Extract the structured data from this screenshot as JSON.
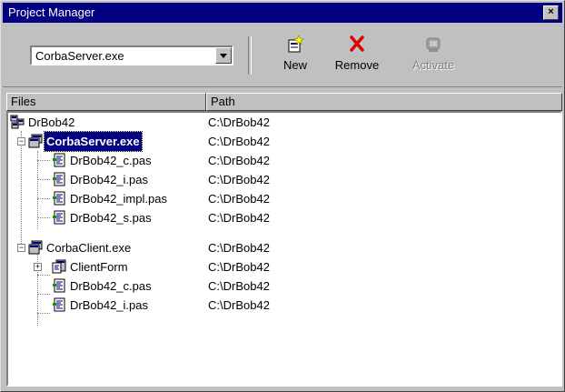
{
  "window": {
    "title": "Project Manager",
    "close_glyph": "×"
  },
  "toolbar": {
    "target_value": "CorbaServer.exe",
    "new_label": "New",
    "remove_label": "Remove",
    "activate_label": "Activate"
  },
  "columns": {
    "files": "Files",
    "path": "Path"
  },
  "tree": [
    {
      "name": "DrBob42",
      "path": "C:\\DrBob42",
      "icon": "project-group-icon"
    },
    {
      "name": "CorbaServer.exe",
      "path": "C:\\DrBob42",
      "icon": "exe-project-icon",
      "selected": true,
      "expanded": true
    },
    {
      "name": "DrBob42_c.pas",
      "path": "C:\\DrBob42",
      "icon": "pas-file-icon"
    },
    {
      "name": "DrBob42_i.pas",
      "path": "C:\\DrBob42",
      "icon": "pas-file-icon"
    },
    {
      "name": "DrBob42_impl.pas",
      "path": "C:\\DrBob42",
      "icon": "pas-file-icon"
    },
    {
      "name": "DrBob42_s.pas",
      "path": "C:\\DrBob42",
      "icon": "pas-file-icon"
    },
    {
      "name": "CorbaClient.exe",
      "path": "C:\\DrBob42",
      "icon": "exe-project-icon",
      "expanded": true
    },
    {
      "name": "ClientForm",
      "path": "C:\\DrBob42",
      "icon": "form-unit-icon",
      "expanded": false
    },
    {
      "name": "DrBob42_c.pas",
      "path": "C:\\DrBob42",
      "icon": "pas-file-icon"
    },
    {
      "name": "DrBob42_i.pas",
      "path": "C:\\DrBob42",
      "icon": "pas-file-icon"
    }
  ],
  "colors": {
    "title_bg": "#000080",
    "face": "#c0c0c0",
    "selection": "#000080",
    "remove_red": "#e00000"
  }
}
